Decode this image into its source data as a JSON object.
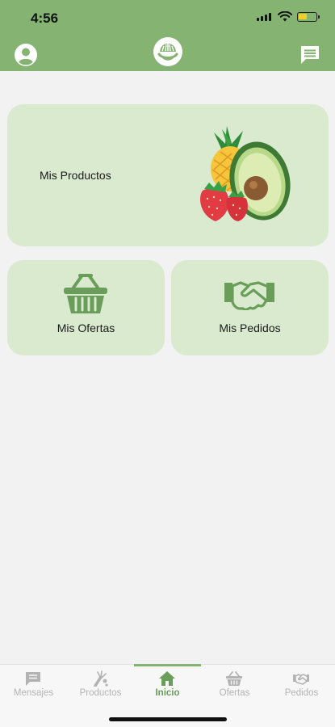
{
  "status_bar": {
    "time": "4:56"
  },
  "header": {
    "profile_icon": "user-circle-icon",
    "logo_icon": "leaf-logo-icon",
    "chat_icon": "message-icon"
  },
  "cards": {
    "products": {
      "label": "Mis Productos",
      "image": "fruit-illustration"
    },
    "offers": {
      "label": "Mis Ofertas",
      "icon": "basket-icon"
    },
    "orders": {
      "label": "Mis Pedidos",
      "icon": "handshake-icon"
    }
  },
  "tabs": [
    {
      "label": "Mensajes",
      "icon": "message-icon",
      "active": false
    },
    {
      "label": "Productos",
      "icon": "produce-icon",
      "active": false
    },
    {
      "label": "Inicio",
      "icon": "home-icon",
      "active": true
    },
    {
      "label": "Ofertas",
      "icon": "basket-icon",
      "active": false
    },
    {
      "label": "Pedidos",
      "icon": "handshake-icon",
      "active": false
    }
  ],
  "colors": {
    "brand": "#84b372",
    "card": "#d9eacf",
    "active_tab": "#6a9c5a",
    "inactive_tab": "#b3b3b3",
    "background": "#f2f2f2"
  }
}
